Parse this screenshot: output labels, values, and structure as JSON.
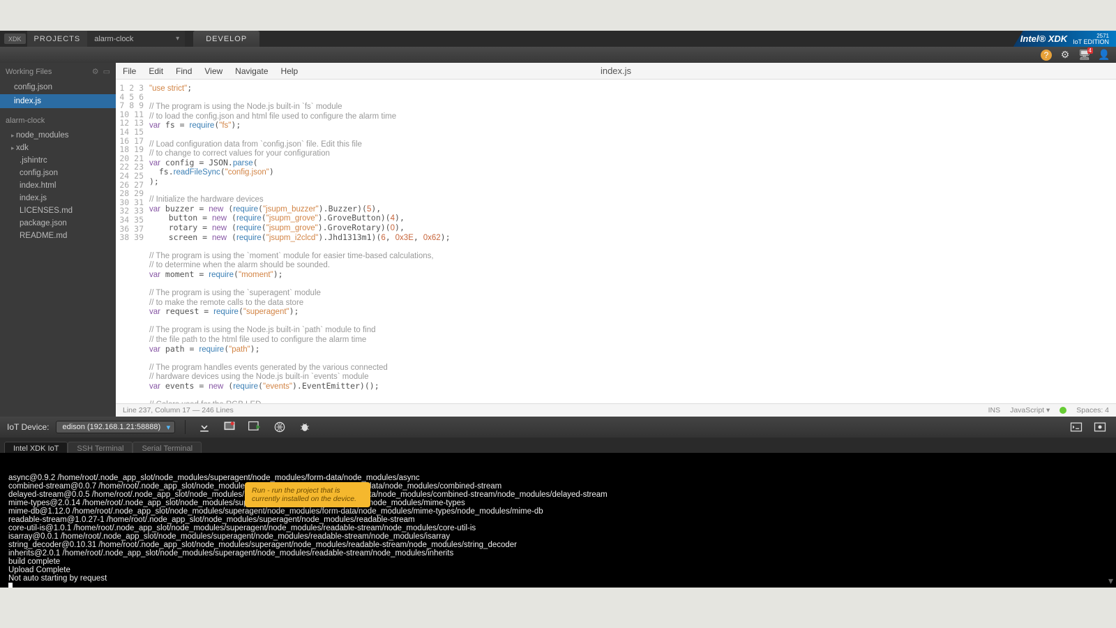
{
  "titlebar": {
    "xdk_badge": "XDK",
    "projects_label": "PROJECTS",
    "project_name": "alarm-clock",
    "develop_tab": "DEVELOP",
    "brand_main": "Intel® XDK",
    "brand_sub": "IoT EDITION",
    "brand_build": "2571"
  },
  "toolbar": {
    "notification_count": "4"
  },
  "sidebar": {
    "working_files_label": "Working Files",
    "working_files": [
      "config.json",
      "index.js"
    ],
    "active_working_file": "index.js",
    "project_root": "alarm-clock",
    "tree": [
      {
        "label": "node_modules",
        "caret": true
      },
      {
        "label": "xdk",
        "caret": true
      },
      {
        "label": ".jshintrc",
        "child": true
      },
      {
        "label": "config.json",
        "child": true
      },
      {
        "label": "index.html",
        "child": true
      },
      {
        "label": "index.js",
        "child": true
      },
      {
        "label": "LICENSES.md",
        "child": true
      },
      {
        "label": "package.json",
        "child": true
      },
      {
        "label": "README.md",
        "child": true
      }
    ]
  },
  "editor": {
    "menus": [
      "File",
      "Edit",
      "Find",
      "View",
      "Navigate",
      "Help"
    ],
    "filename": "index.js",
    "status_left": "Line 237, Column 17 — 246 Lines",
    "status_ins": "INS",
    "status_lang": "JavaScript  ▾",
    "status_spaces": "Spaces: 4",
    "line_count": 39
  },
  "devicebar": {
    "label": "IoT Device:",
    "selected": "edison (192.168.1.21:58888)"
  },
  "tooltip": "Run - run the project that is currently installed on the device.",
  "terminal": {
    "tabs": [
      "Intel XDK IoT",
      "SSH Terminal",
      "Serial Terminal"
    ],
    "active_tab": "Intel XDK IoT",
    "lines": [
      "async@0.9.2 /home/root/.node_app_slot/node_modules/superagent/node_modules/form-data/node_modules/async",
      "combined-stream@0.0.7 /home/root/.node_app_slot/node_modules/superagent/node_modules/form-data/node_modules/combined-stream",
      "delayed-stream@0.0.5 /home/root/.node_app_slot/node_modules/superagent/node_modules/form-data/node_modules/combined-stream/node_modules/delayed-stream",
      "mime-types@2.0.14 /home/root/.node_app_slot/node_modules/superagent/node_modules/form-data/node_modules/mime-types",
      "mime-db@1.12.0 /home/root/.node_app_slot/node_modules/superagent/node_modules/form-data/node_modules/mime-types/node_modules/mime-db",
      "readable-stream@1.0.27-1 /home/root/.node_app_slot/node_modules/superagent/node_modules/readable-stream",
      "core-util-is@1.0.1 /home/root/.node_app_slot/node_modules/superagent/node_modules/readable-stream/node_modules/core-util-is",
      "isarray@0.0.1 /home/root/.node_app_slot/node_modules/superagent/node_modules/readable-stream/node_modules/isarray",
      "string_decoder@0.10.31 /home/root/.node_app_slot/node_modules/superagent/node_modules/readable-stream/node_modules/string_decoder",
      "inherits@2.0.1 /home/root/.node_app_slot/node_modules/superagent/node_modules/readable-stream/node_modules/inherits",
      "build complete",
      "Upload Complete",
      "Not auto starting by request"
    ]
  }
}
